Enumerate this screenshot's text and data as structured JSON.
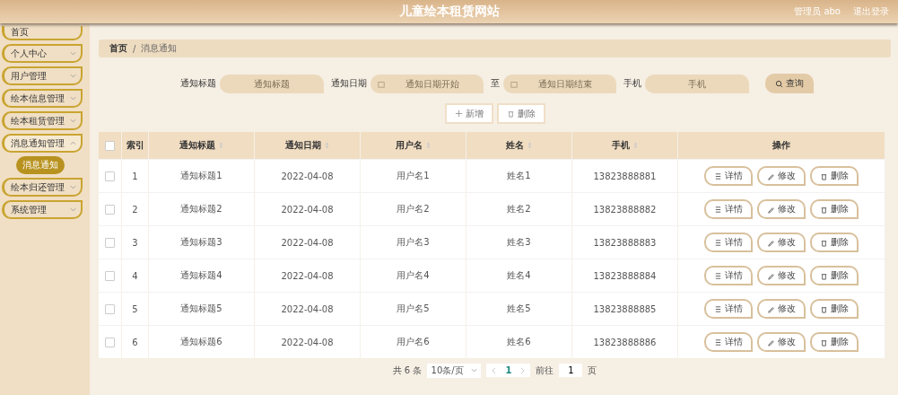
{
  "header": {
    "title": "儿童绘本租赁网站",
    "user": "管理员 abo",
    "logout": "退出登录"
  },
  "sidebar": {
    "items": [
      {
        "label": "首页",
        "expanded": false
      },
      {
        "label": "个人中心",
        "expanded": false
      },
      {
        "label": "用户管理",
        "expanded": false
      },
      {
        "label": "绘本信息管理",
        "expanded": false
      },
      {
        "label": "绘本租赁管理",
        "expanded": false
      },
      {
        "label": "消息通知管理",
        "expanded": true,
        "children": [
          {
            "label": "消息通知",
            "selected": true
          }
        ]
      },
      {
        "label": "绘本归还管理",
        "expanded": false
      },
      {
        "label": "系统管理",
        "expanded": false
      }
    ]
  },
  "breadcrumb": {
    "items": [
      "首页",
      "消息通知"
    ],
    "separator": "/"
  },
  "search": {
    "fields": [
      {
        "label": "通知标题",
        "kind": "text",
        "placeholder": "通知标题"
      },
      {
        "label": "通知日期",
        "kind": "daterange",
        "placeholder": "通知日期开始",
        "separator": "至",
        "placeholder2": "通知日期结束"
      },
      {
        "label": "手机",
        "kind": "text",
        "placeholder": "手机"
      }
    ],
    "button": "查询"
  },
  "actions": [
    "新增",
    "删除"
  ],
  "table": {
    "all_checked": false,
    "columns": [
      {
        "label": "索引",
        "sortable": false
      },
      {
        "label": "通知标题",
        "sortable": true
      },
      {
        "label": "通知日期",
        "sortable": true
      },
      {
        "label": "用户名",
        "sortable": true
      },
      {
        "label": "姓名",
        "sortable": true
      },
      {
        "label": "手机",
        "sortable": true
      },
      {
        "label": "操作",
        "sortable": false
      }
    ],
    "rows": [
      {
        "checked": false,
        "cells": [
          "1",
          "通知标题1",
          "2022-04-08",
          "用户名1",
          "姓名1",
          "13823888881"
        ],
        "actions": [
          "详情",
          "修改",
          "删除"
        ]
      },
      {
        "checked": false,
        "cells": [
          "2",
          "通知标题2",
          "2022-04-08",
          "用户名2",
          "姓名2",
          "13823888882"
        ],
        "actions": [
          "详情",
          "修改",
          "删除"
        ]
      },
      {
        "checked": false,
        "cells": [
          "3",
          "通知标题3",
          "2022-04-08",
          "用户名3",
          "姓名3",
          "13823888883"
        ],
        "actions": [
          "详情",
          "修改",
          "删除"
        ]
      },
      {
        "checked": false,
        "cells": [
          "4",
          "通知标题4",
          "2022-04-08",
          "用户名4",
          "姓名4",
          "13823888884"
        ],
        "actions": [
          "详情",
          "修改",
          "删除"
        ]
      },
      {
        "checked": false,
        "cells": [
          "5",
          "通知标题5",
          "2022-04-08",
          "用户名5",
          "姓名5",
          "13823888885"
        ],
        "actions": [
          "详情",
          "修改",
          "删除"
        ]
      },
      {
        "checked": false,
        "cells": [
          "6",
          "通知标题6",
          "2022-04-08",
          "用户名6",
          "姓名6",
          "13823888886"
        ],
        "actions": [
          "详情",
          "修改",
          "删除"
        ]
      }
    ]
  },
  "pagination": {
    "total": "共 6 条",
    "page_size": "10条/页",
    "pages": [
      {
        "label": "1",
        "selected": true
      }
    ],
    "goto_label": "前往",
    "goto_value": "1",
    "goto_unit": "页"
  }
}
